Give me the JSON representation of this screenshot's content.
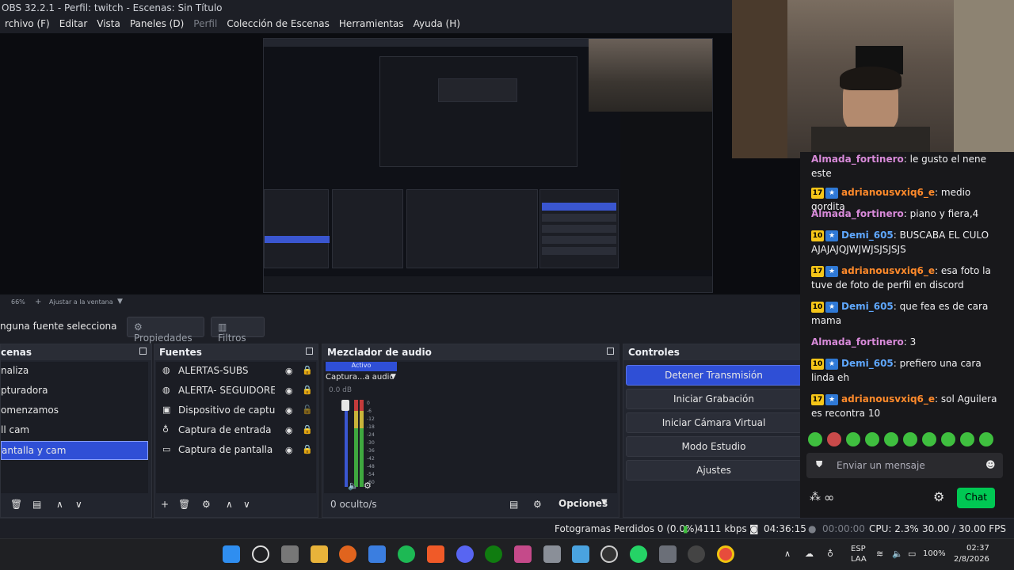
{
  "window": {
    "title": "OBS 32.2.1 - Perfil: twitch - Escenas: Sin Título"
  },
  "menu": [
    "rchivo (F)",
    "Editar",
    "Vista",
    "Paneles (D)",
    "Perfil",
    "Colección de Escenas",
    "Herramientas",
    "Ayuda (H)"
  ],
  "preview": {
    "zoom": "66%",
    "fit_label": "Ajustar a la ventana"
  },
  "toolbar": {
    "no_source": "nguna fuente selecciona",
    "properties": "Propiedades",
    "filters": "Filtros"
  },
  "scenes": {
    "title": "cenas",
    "items": [
      "nalizа",
      "pturadora",
      "omenzamos",
      "ll cam",
      "antalla y cam"
    ],
    "selected_index": 4
  },
  "sources": {
    "title": "Fuentes",
    "items": [
      {
        "label": "ALERTAS-SUBS",
        "icon": "globe-icon"
      },
      {
        "label": "ALERTA- SEGUIDORES",
        "icon": "globe-icon"
      },
      {
        "label": "Dispositivo de captura de",
        "icon": "camera-icon"
      },
      {
        "label": "Captura de entrada audio",
        "icon": "mic-icon"
      },
      {
        "label": "Captura de pantalla",
        "icon": "monitor-icon"
      }
    ]
  },
  "mixer": {
    "title": "Mezclador de audio",
    "tab": "Activo",
    "channel": "Captura...a audio",
    "db": "0.0 dB",
    "scale": [
      "0",
      "-6",
      "-12",
      "-18",
      "-24",
      "-30",
      "-36",
      "-42",
      "-48",
      "-54",
      "-60"
    ],
    "hidden": "0 oculto/s",
    "options": "Opciones"
  },
  "controls": {
    "title": "Controles",
    "buttons": [
      "Detener Transmisión",
      "Iniciar Grabación",
      "Iniciar Cámara Virtual",
      "Modo Estudio",
      "Ajustes"
    ]
  },
  "status": {
    "dropped": "Fotogramas Perdidos 0 (0.0%)",
    "kbps": "4111 kbps",
    "stream_time": "04:36:15",
    "rec_time": "00:00:00",
    "cpu": "CPU: 2.3%",
    "fps": "30.00 / 30.00 FPS"
  },
  "chat": {
    "messages": [
      {
        "badge": "",
        "user": "Almada_fortinero",
        "color": "#e0a25a",
        "text": "le gusto el nene este"
      },
      {
        "badge": "17",
        "user": "adrianousvxiq6_e",
        "color": "#ff8a2b",
        "text": "medio gordita"
      },
      {
        "badge": "",
        "user": "Almada_fortinero",
        "color": "#d88ad9",
        "text": "piano y fiera,4"
      },
      {
        "badge": "10",
        "user": "Demi_605",
        "color": "#5fa8ff",
        "text": "BUSCABA EL CULO AJAJAJQJWJWJSJSJSJS"
      },
      {
        "badge": "17",
        "user": "adrianousvxiq6_e",
        "color": "#ff8a2b",
        "text": "esa foto la tuve de foto de perfil en discord"
      },
      {
        "badge": "10",
        "user": "Demi_605",
        "color": "#5fa8ff",
        "text": "que fea es de cara mama"
      },
      {
        "badge": "",
        "user": "Almada_fortinero",
        "color": "#d88ad9",
        "text": "3"
      },
      {
        "badge": "10",
        "user": "Demi_605",
        "color": "#5fa8ff",
        "text": "prefiero una cara linda eh"
      },
      {
        "badge": "17",
        "user": "adrianousvxiq6_e",
        "color": "#ff8a2b",
        "text": "sol Aguilera es recontra 10"
      }
    ],
    "placeholder": "Enviar un mensaje",
    "send_label": "Chat",
    "infinity": "∞"
  },
  "taskbar": {
    "lang": "ESP",
    "lang2": "LAA",
    "battery": "100%",
    "time": "02:37",
    "date": "2/8/2026"
  },
  "colors": {
    "accent": "#2f4fd6",
    "chat_btn": "#00c853"
  }
}
